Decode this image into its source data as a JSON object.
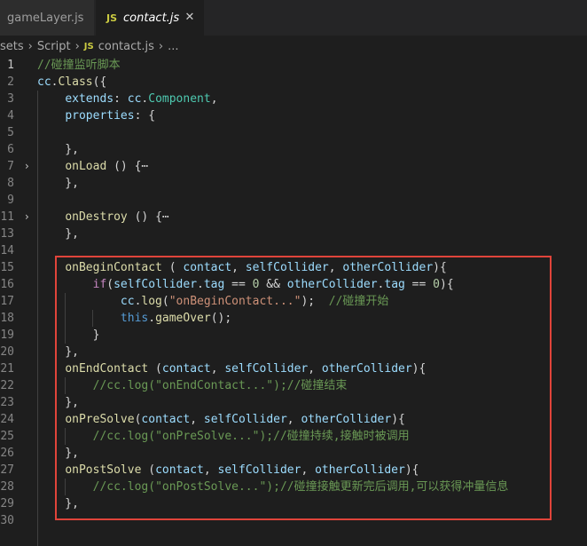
{
  "tabs": [
    {
      "label": "gameLayer.js",
      "active": false
    },
    {
      "label": "contact.js",
      "active": true,
      "badge": "JS"
    }
  ],
  "breadcrumbs": {
    "p1": "sets",
    "p2": "Script",
    "badge": "JS",
    "p3": "contact.js",
    "p4": "..."
  },
  "icons": {
    "close": "close-icon",
    "fold": "chevron-right-icon"
  },
  "colors": {
    "highlight_border": "#e0443a",
    "editor_bg": "#1e1e1e",
    "comment": "#6a9955",
    "string": "#ce9178",
    "keyword": "#c586c0"
  },
  "lines": [
    {
      "n": 1,
      "fold": false,
      "tokens": [
        {
          "t": "//碰撞监听脚本",
          "c": "comment"
        }
      ]
    },
    {
      "n": 2,
      "fold": false,
      "tokens": [
        {
          "t": "cc",
          "c": "var"
        },
        {
          "t": ".",
          "c": "plain"
        },
        {
          "t": "Class",
          "c": "fn"
        },
        {
          "t": "({",
          "c": "plain"
        }
      ]
    },
    {
      "n": 3,
      "fold": false,
      "tokens": [
        {
          "t": "    ",
          "c": "plain"
        },
        {
          "t": "extends",
          "c": "var"
        },
        {
          "t": ": ",
          "c": "plain"
        },
        {
          "t": "cc",
          "c": "var"
        },
        {
          "t": ".",
          "c": "plain"
        },
        {
          "t": "Component",
          "c": "class"
        },
        {
          "t": ",",
          "c": "plain"
        }
      ]
    },
    {
      "n": 4,
      "fold": false,
      "tokens": [
        {
          "t": "    ",
          "c": "plain"
        },
        {
          "t": "properties",
          "c": "var"
        },
        {
          "t": ": {",
          "c": "plain"
        }
      ]
    },
    {
      "n": 5,
      "fold": false,
      "tokens": []
    },
    {
      "n": 6,
      "fold": false,
      "tokens": [
        {
          "t": "    },",
          "c": "plain"
        }
      ]
    },
    {
      "n": 7,
      "fold": true,
      "tokens": [
        {
          "t": "    ",
          "c": "plain"
        },
        {
          "t": "onLoad",
          "c": "fn"
        },
        {
          "t": " () {⋯",
          "c": "plain"
        }
      ]
    },
    {
      "n": 8,
      "fold": false,
      "tokens": [
        {
          "t": "    },",
          "c": "plain"
        }
      ]
    },
    {
      "n": 9,
      "fold": false,
      "tokens": []
    },
    {
      "n": 11,
      "fold": true,
      "tokens": [
        {
          "t": "    ",
          "c": "plain"
        },
        {
          "t": "onDestroy",
          "c": "fn"
        },
        {
          "t": " () {⋯",
          "c": "plain"
        }
      ]
    },
    {
      "n": 13,
      "fold": false,
      "tokens": [
        {
          "t": "    },",
          "c": "plain"
        }
      ]
    },
    {
      "n": 14,
      "fold": false,
      "tokens": []
    },
    {
      "n": 15,
      "fold": false,
      "tokens": [
        {
          "t": "    ",
          "c": "plain"
        },
        {
          "t": "onBeginContact",
          "c": "fn"
        },
        {
          "t": " ( ",
          "c": "plain"
        },
        {
          "t": "contact",
          "c": "var"
        },
        {
          "t": ", ",
          "c": "plain"
        },
        {
          "t": "selfCollider",
          "c": "var"
        },
        {
          "t": ", ",
          "c": "plain"
        },
        {
          "t": "otherCollider",
          "c": "var"
        },
        {
          "t": "){",
          "c": "plain"
        }
      ]
    },
    {
      "n": 16,
      "fold": false,
      "tokens": [
        {
          "t": "        ",
          "c": "plain"
        },
        {
          "t": "if",
          "c": "kw"
        },
        {
          "t": "(",
          "c": "plain"
        },
        {
          "t": "selfCollider",
          "c": "var"
        },
        {
          "t": ".",
          "c": "plain"
        },
        {
          "t": "tag",
          "c": "var"
        },
        {
          "t": " == ",
          "c": "plain"
        },
        {
          "t": "0",
          "c": "num"
        },
        {
          "t": " && ",
          "c": "plain"
        },
        {
          "t": "otherCollider",
          "c": "var"
        },
        {
          "t": ".",
          "c": "plain"
        },
        {
          "t": "tag",
          "c": "var"
        },
        {
          "t": " == ",
          "c": "plain"
        },
        {
          "t": "0",
          "c": "num"
        },
        {
          "t": "){",
          "c": "plain"
        }
      ]
    },
    {
      "n": 17,
      "fold": false,
      "tokens": [
        {
          "t": "            ",
          "c": "plain"
        },
        {
          "t": "cc",
          "c": "var"
        },
        {
          "t": ".",
          "c": "plain"
        },
        {
          "t": "log",
          "c": "fn"
        },
        {
          "t": "(",
          "c": "plain"
        },
        {
          "t": "\"onBeginContact...\"",
          "c": "str"
        },
        {
          "t": ");  ",
          "c": "plain"
        },
        {
          "t": "//碰撞开始",
          "c": "comment"
        }
      ]
    },
    {
      "n": 18,
      "fold": false,
      "tokens": [
        {
          "t": "            ",
          "c": "plain"
        },
        {
          "t": "this",
          "c": "this"
        },
        {
          "t": ".",
          "c": "plain"
        },
        {
          "t": "gameOver",
          "c": "fn"
        },
        {
          "t": "();",
          "c": "plain"
        }
      ]
    },
    {
      "n": 19,
      "fold": false,
      "tokens": [
        {
          "t": "        }",
          "c": "plain"
        }
      ]
    },
    {
      "n": 20,
      "fold": false,
      "tokens": [
        {
          "t": "    },",
          "c": "plain"
        }
      ]
    },
    {
      "n": 21,
      "fold": false,
      "tokens": [
        {
          "t": "    ",
          "c": "plain"
        },
        {
          "t": "onEndContact",
          "c": "fn"
        },
        {
          "t": " (",
          "c": "plain"
        },
        {
          "t": "contact",
          "c": "var"
        },
        {
          "t": ", ",
          "c": "plain"
        },
        {
          "t": "selfCollider",
          "c": "var"
        },
        {
          "t": ", ",
          "c": "plain"
        },
        {
          "t": "otherCollider",
          "c": "var"
        },
        {
          "t": "){",
          "c": "plain"
        }
      ]
    },
    {
      "n": 22,
      "fold": false,
      "tokens": [
        {
          "t": "        ",
          "c": "plain"
        },
        {
          "t": "//cc.log(\"onEndContact...\");//碰撞结束",
          "c": "comment"
        }
      ]
    },
    {
      "n": 23,
      "fold": false,
      "tokens": [
        {
          "t": "    },",
          "c": "plain"
        }
      ]
    },
    {
      "n": 24,
      "fold": false,
      "tokens": [
        {
          "t": "    ",
          "c": "plain"
        },
        {
          "t": "onPreSolve",
          "c": "fn"
        },
        {
          "t": "(",
          "c": "plain"
        },
        {
          "t": "contact",
          "c": "var"
        },
        {
          "t": ", ",
          "c": "plain"
        },
        {
          "t": "selfCollider",
          "c": "var"
        },
        {
          "t": ", ",
          "c": "plain"
        },
        {
          "t": "otherCollider",
          "c": "var"
        },
        {
          "t": "){",
          "c": "plain"
        }
      ]
    },
    {
      "n": 25,
      "fold": false,
      "tokens": [
        {
          "t": "        ",
          "c": "plain"
        },
        {
          "t": "//cc.log(\"onPreSolve...\");//碰撞持续,接触时被调用",
          "c": "comment"
        }
      ]
    },
    {
      "n": 26,
      "fold": false,
      "tokens": [
        {
          "t": "    },",
          "c": "plain"
        }
      ]
    },
    {
      "n": 27,
      "fold": false,
      "tokens": [
        {
          "t": "    ",
          "c": "plain"
        },
        {
          "t": "onPostSolve",
          "c": "fn"
        },
        {
          "t": " (",
          "c": "plain"
        },
        {
          "t": "contact",
          "c": "var"
        },
        {
          "t": ", ",
          "c": "plain"
        },
        {
          "t": "selfCollider",
          "c": "var"
        },
        {
          "t": ", ",
          "c": "plain"
        },
        {
          "t": "otherCollider",
          "c": "var"
        },
        {
          "t": "){",
          "c": "plain"
        }
      ]
    },
    {
      "n": 28,
      "fold": false,
      "tokens": [
        {
          "t": "        ",
          "c": "plain"
        },
        {
          "t": "//cc.log(\"onPostSolve...\");//碰撞接触更新完后调用,可以获得冲量信息",
          "c": "comment"
        }
      ]
    },
    {
      "n": 29,
      "fold": false,
      "tokens": [
        {
          "t": "    },",
          "c": "plain"
        }
      ]
    },
    {
      "n": 30,
      "fold": false,
      "tokens": []
    }
  ]
}
